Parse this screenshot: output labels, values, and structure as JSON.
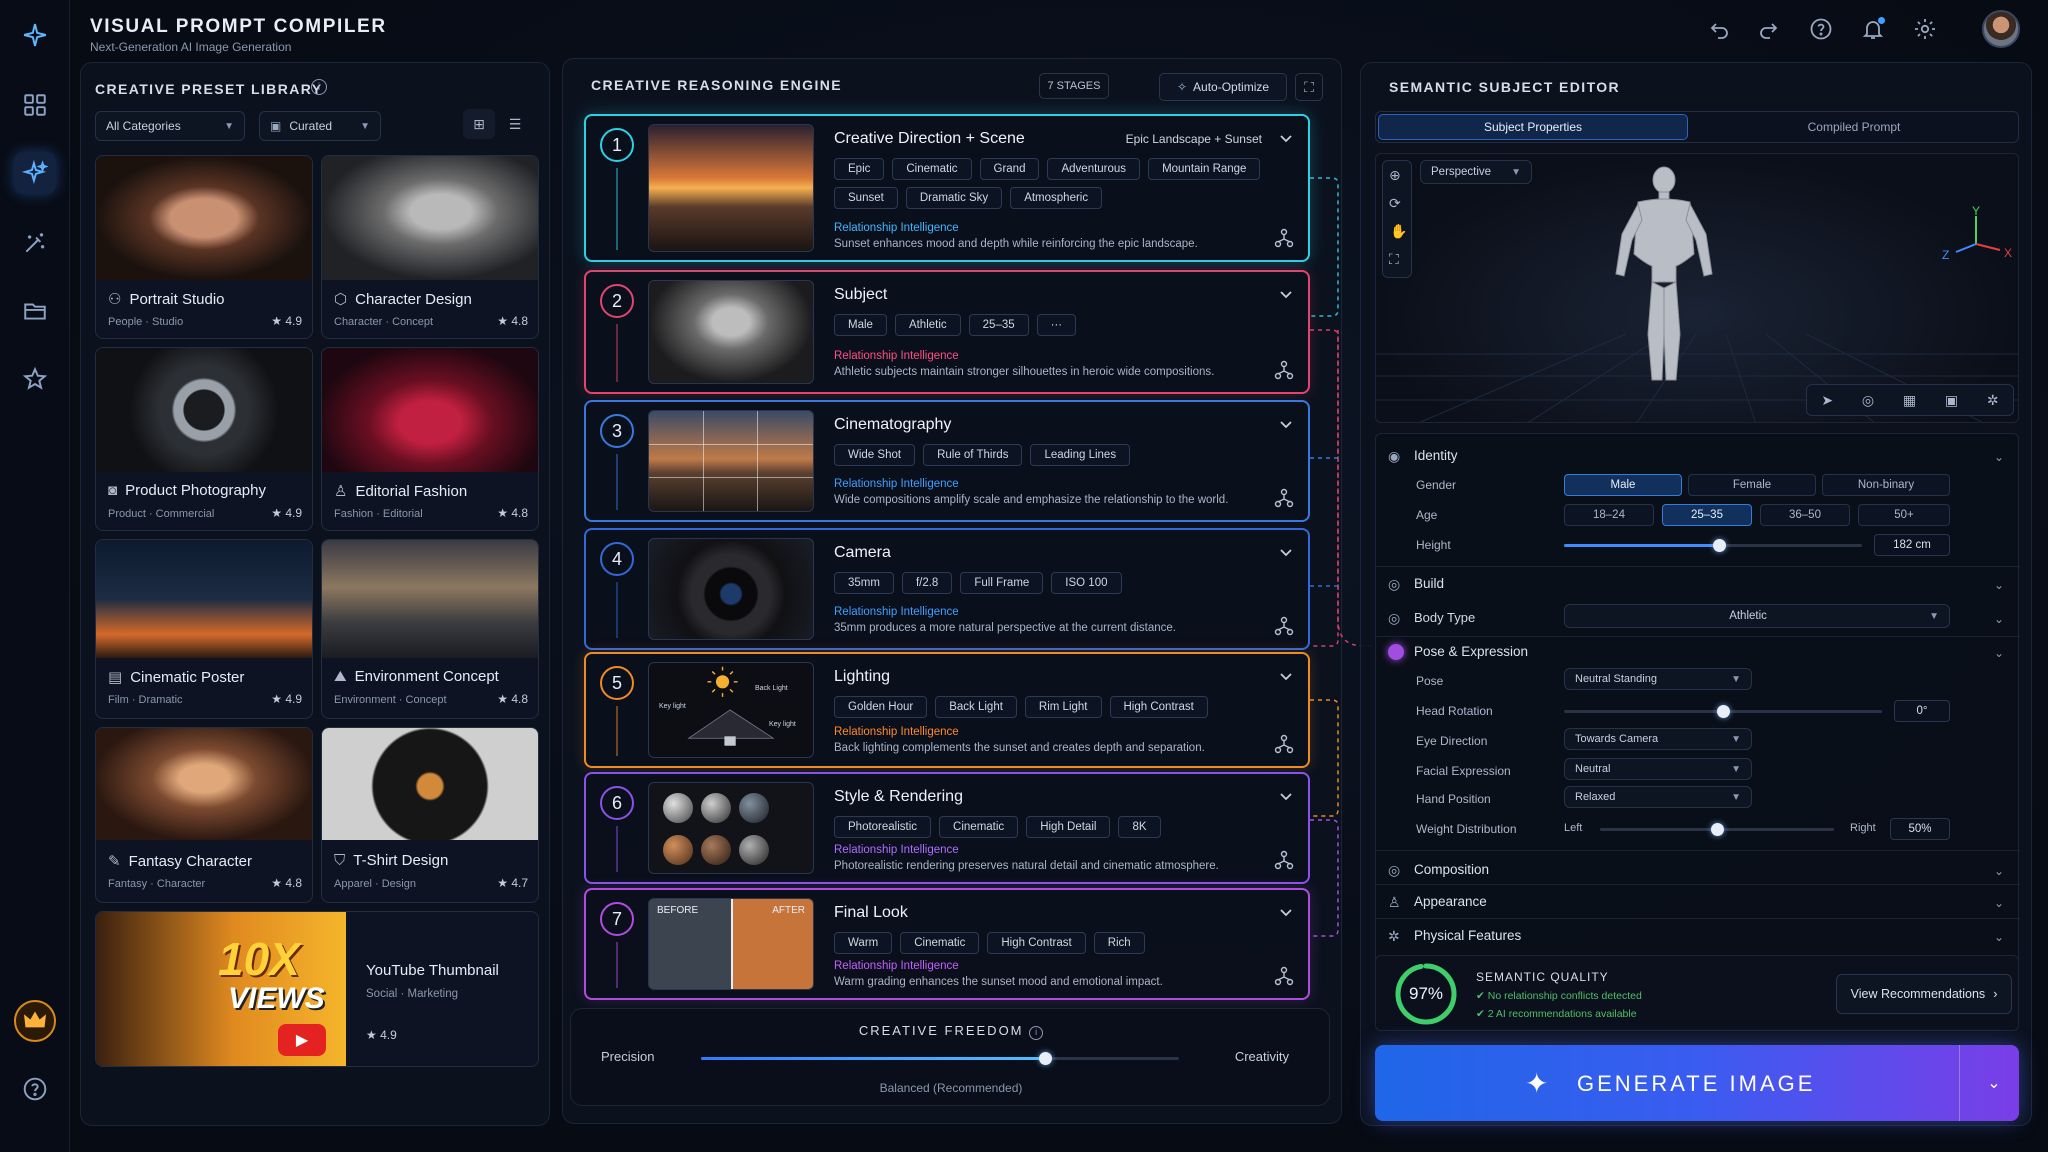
{
  "app": {
    "title": "VISUAL PROMPT COMPILER",
    "subtitle": "Next-Generation AI Image Generation"
  },
  "library": {
    "title": "CREATIVE PRESET LIBRARY",
    "filter_category": "All Categories",
    "filter_sort": "Curated",
    "presets": [
      {
        "label": "Portrait Studio",
        "meta": "People · Studio",
        "rating": "4.9",
        "icon": "people-icon"
      },
      {
        "label": "Character Design",
        "meta": "Character · Concept",
        "rating": "4.8",
        "icon": "cube-icon"
      },
      {
        "label": "Product Photography",
        "meta": "Product · Commercial",
        "rating": "4.9",
        "icon": "camera-icon"
      },
      {
        "label": "Editorial Fashion",
        "meta": "Fashion · Editorial",
        "rating": "4.8",
        "icon": "person-icon"
      },
      {
        "label": "Cinematic Poster",
        "meta": "Film · Dramatic",
        "rating": "4.9",
        "icon": "film-icon"
      },
      {
        "label": "Environment Concept",
        "meta": "Environment · Concept",
        "rating": "4.8",
        "icon": "mountain-icon"
      },
      {
        "label": "Fantasy Character",
        "meta": "Fantasy · Character",
        "rating": "4.8",
        "icon": "quill-icon"
      },
      {
        "label": "T-Shirt Design",
        "meta": "Apparel · Design",
        "rating": "4.7",
        "icon": "shirt-icon"
      }
    ],
    "youtube": {
      "label": "YouTube Thumbnail",
      "meta": "Social · Marketing",
      "rating": "4.9",
      "badge_line1": "10X",
      "badge_line2": "VIEWS"
    }
  },
  "engine": {
    "title": "CREATIVE REASONING ENGINE",
    "stages_badge": "7 STAGES",
    "auto_optimize": "Auto-Optimize",
    "ri_label": "Relationship Intelligence",
    "stages": [
      {
        "num": "1",
        "title": "Creative Direction + Scene",
        "right": "Epic Landscape + Sunset",
        "color": "#2fd0e6",
        "ri_color": "#3fb8ff",
        "chips": [
          "Epic",
          "Cinematic",
          "Grand",
          "Adventurous",
          "Mountain Range",
          "Sunset",
          "Dramatic Sky",
          "Atmospheric"
        ],
        "text": "Sunset enhances mood and depth while reinforcing the epic landscape."
      },
      {
        "num": "2",
        "title": "Subject",
        "right": "",
        "color": "#e0456e",
        "ri_color": "#ff4f86",
        "chips": [
          "Male",
          "Athletic",
          "25–35",
          "···"
        ],
        "text": "Athletic subjects maintain stronger silhouettes in heroic wide compositions."
      },
      {
        "num": "3",
        "title": "Cinematography",
        "right": "",
        "color": "#3a78e0",
        "ri_color": "#3fa0ff",
        "chips": [
          "Wide Shot",
          "Rule of Thirds",
          "Leading Lines"
        ],
        "text": "Wide compositions amplify scale and emphasize the relationship to the world."
      },
      {
        "num": "4",
        "title": "Camera",
        "right": "",
        "color": "#3468d8",
        "ri_color": "#3fa0ff",
        "chips": [
          "35mm",
          "f/2.8",
          "Full Frame",
          "ISO 100"
        ],
        "text": "35mm produces a more natural perspective at the current distance."
      },
      {
        "num": "5",
        "title": "Lighting",
        "right": "",
        "color": "#f08a24",
        "ri_color": "#ff8a2a",
        "chips": [
          "Golden Hour",
          "Back Light",
          "Rim Light",
          "High Contrast"
        ],
        "text": "Back lighting complements the sunset and creates depth and separation."
      },
      {
        "num": "6",
        "title": "Style & Rendering",
        "right": "",
        "color": "#8a52e8",
        "ri_color": "#b06cff",
        "chips": [
          "Photorealistic",
          "Cinematic",
          "High Detail",
          "8K"
        ],
        "text": "Photorealistic rendering preserves natural detail and cinematic atmosphere."
      },
      {
        "num": "7",
        "title": "Final Look",
        "right": "",
        "color": "#b04ce0",
        "ri_color": "#c560ff",
        "chips": [
          "Warm",
          "Cinematic",
          "High Contrast",
          "Rich"
        ],
        "text": "Warm grading enhances the sunset mood and emotional impact."
      }
    ],
    "lighting_labels": {
      "key1": "Key light",
      "back": "Back Light",
      "key2": "Key light"
    },
    "final_labels": {
      "before": "BEFORE",
      "after": "AFTER"
    },
    "freedom": {
      "title": "CREATIVE FREEDOM",
      "left": "Precision",
      "right": "Creativity",
      "caption": "Balanced (Recommended)",
      "value": 0.72
    }
  },
  "editor": {
    "title": "SEMANTIC SUBJECT EDITOR",
    "tabs": [
      "Subject Properties",
      "Compiled Prompt"
    ],
    "view_mode": "Perspective",
    "axes": {
      "x": "X",
      "y": "Y",
      "z": "Z"
    },
    "identity": {
      "title": "Identity",
      "gender_label": "Gender",
      "genders": [
        "Male",
        "Female",
        "Non-binary"
      ],
      "age_label": "Age",
      "ages": [
        "18–24",
        "25–35",
        "36–50",
        "50+"
      ],
      "height_label": "Height",
      "height_value": "182 cm",
      "height_level": 0.52
    },
    "build_title": "Build",
    "body_type_label": "Body Type",
    "body_type_value": "Athletic",
    "pose": {
      "title": "Pose & Expression",
      "pose_label": "Pose",
      "pose_value": "Neutral Standing",
      "head_label": "Head Rotation",
      "head_value": "0°",
      "head_level": 0.5,
      "eye_label": "Eye Direction",
      "eye_value": "Towards Camera",
      "face_label": "Facial Expression",
      "face_value": "Neutral",
      "hand_label": "Hand Position",
      "hand_value": "Relaxed",
      "weight_label": "Weight Distribution",
      "weight_left": "Left",
      "weight_right": "Right",
      "weight_value": "50%",
      "weight_level": 0.5
    },
    "sections": [
      "Composition",
      "Appearance",
      "Physical Features"
    ],
    "quality": {
      "title": "SEMANTIC QUALITY",
      "score": "97%",
      "score_level": 0.97,
      "line1": "No relationship conflicts detected",
      "line2": "2 AI recommendations available",
      "button": "View Recommendations"
    },
    "generate": "GENERATE IMAGE"
  }
}
